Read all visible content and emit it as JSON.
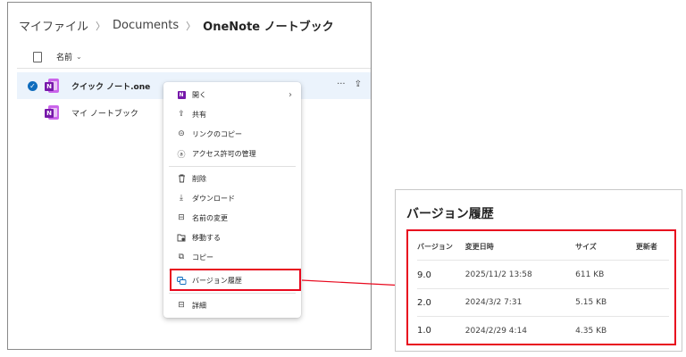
{
  "breadcrumb": {
    "root": "マイファイル",
    "folder": "Documents",
    "current": "OneNote ノートブック"
  },
  "file_list": {
    "name_header": "名前",
    "rows": [
      {
        "name": "クイック ノート.one",
        "selected": true
      },
      {
        "name": "マイ ノートブック",
        "selected": false
      }
    ],
    "row_actions": {
      "more": "···",
      "share": "⇪"
    }
  },
  "context_menu": {
    "items": [
      {
        "label": "開く",
        "icon": "open-icon",
        "glyph": "N",
        "has_submenu": true
      },
      {
        "label": "共有",
        "icon": "share-icon",
        "glyph": "⇪"
      },
      {
        "label": "リンクのコピー",
        "icon": "link-icon",
        "glyph": "⊝"
      },
      {
        "label": "アクセス許可の管理",
        "icon": "person-icon",
        "glyph": "ⓐ"
      },
      {
        "label": "削除",
        "icon": "trash-icon",
        "glyph": "🗑"
      },
      {
        "label": "ダウンロード",
        "icon": "download-icon",
        "glyph": "⤓"
      },
      {
        "label": "名前の変更",
        "icon": "rename-icon",
        "glyph": "⊟"
      },
      {
        "label": "移動する",
        "icon": "move-icon",
        "glyph": "⧉"
      },
      {
        "label": "コピー",
        "icon": "copy-icon",
        "glyph": "⧉"
      },
      {
        "label": "バージョン履歴",
        "icon": "version-history-icon",
        "glyph": "⧉"
      },
      {
        "label": "詳細",
        "icon": "details-icon",
        "glyph": "⊟"
      }
    ]
  },
  "version_history": {
    "title": "バージョン履歴",
    "headers": [
      "バージョン",
      "変更日時",
      "サイズ",
      "更新者"
    ],
    "rows": [
      [
        "9.0",
        "2025/11/2 13:58",
        "611 KB",
        ""
      ],
      [
        "2.0",
        "2024/3/2 7:31",
        "5.15 KB",
        ""
      ],
      [
        "1.0",
        "2024/2/29 4:14",
        "4.35 KB",
        ""
      ]
    ]
  },
  "colors": {
    "accent": "#0f6cbd",
    "onenote_purple": "#7719aa",
    "highlight_red": "#e8091e",
    "selected_row": "#ebf3fc"
  }
}
